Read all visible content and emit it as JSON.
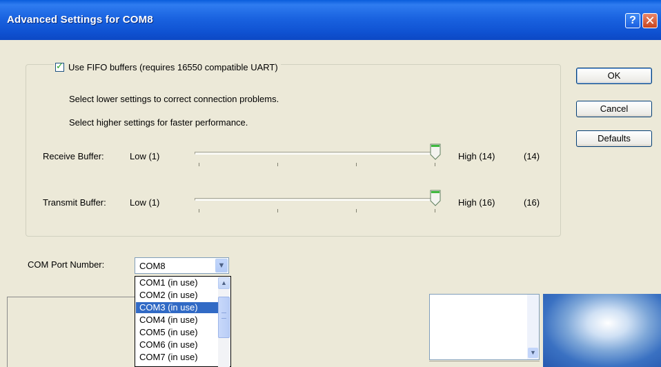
{
  "window": {
    "title": "Advanced Settings for COM8",
    "help_label": "?",
    "close_label": "✕"
  },
  "fifo": {
    "checked": true,
    "label": "Use FIFO buffers (requires 16550 compatible UART)"
  },
  "hints": [
    "Select lower settings to correct connection problems.",
    "Select higher settings for faster performance."
  ],
  "receive_buffer": {
    "label": "Receive Buffer:",
    "low_label": "Low (1)",
    "high_label": "High (14)",
    "value_display": "(14)",
    "value": 14,
    "min": 1,
    "max": 14
  },
  "transmit_buffer": {
    "label": "Transmit Buffer:",
    "low_label": "Low (1)",
    "high_label": "High (16)",
    "value_display": "(16)",
    "value": 16,
    "min": 1,
    "max": 16
  },
  "buttons": {
    "ok": "OK",
    "cancel": "Cancel",
    "defaults": "Defaults"
  },
  "com_port": {
    "label": "COM Port Number:",
    "selected": "COM8",
    "options": [
      "COM1 (in use)",
      "COM2 (in use)",
      "COM3 (in use)",
      "COM4 (in use)",
      "COM5 (in use)",
      "COM6 (in use)",
      "COM7 (in use)"
    ],
    "highlighted_option": "COM3 (in use)"
  },
  "icons": {
    "checkbox_mark": "✓",
    "dropdown_arrow": "chevron-down-icon",
    "scroll_up": "chevron-up-icon",
    "scroll_down": "chevron-down-icon"
  },
  "colors": {
    "titlebar": "#0f52d2",
    "selection": "#316ac5",
    "dialog_bg": "#ece9d8"
  }
}
